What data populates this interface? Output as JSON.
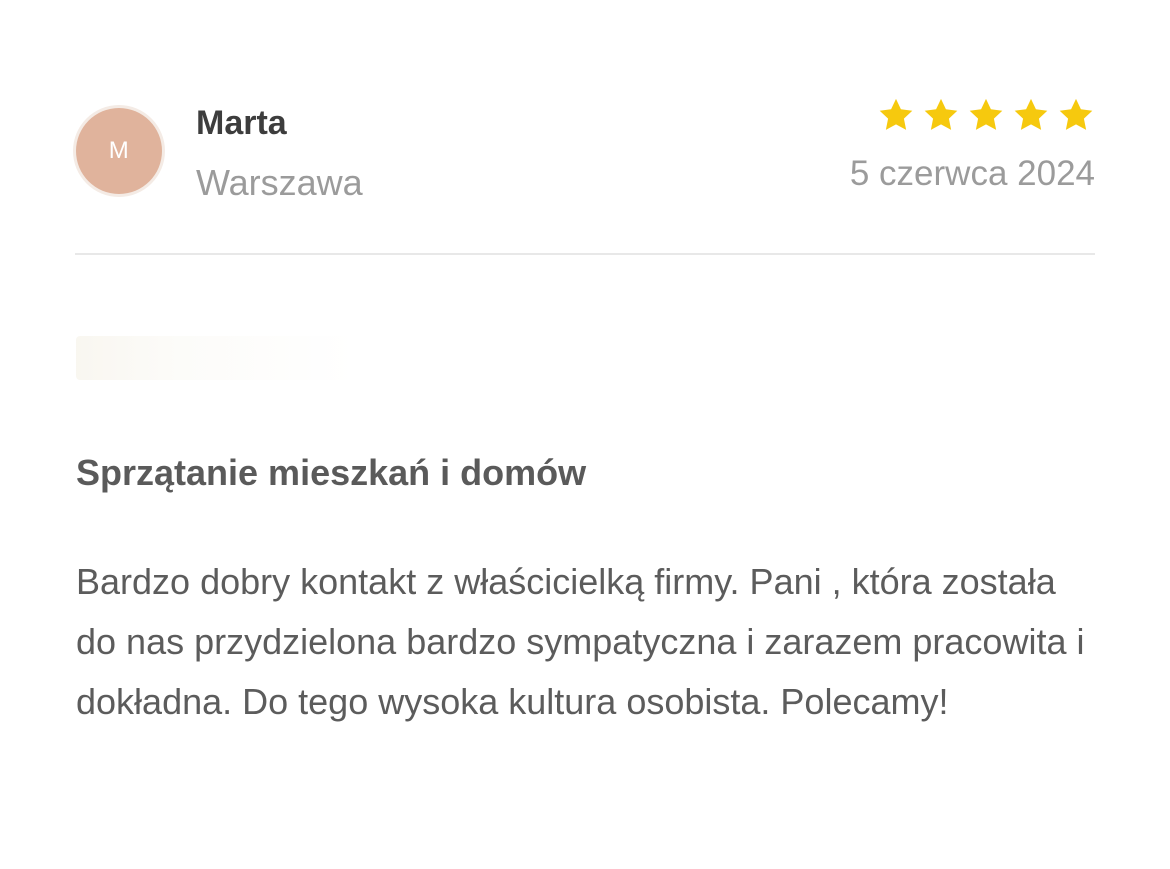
{
  "review": {
    "avatar_letter": "M",
    "name": "Marta",
    "city": "Warszawa",
    "rating": 5,
    "rating_max": 5,
    "date": "5 czerwca 2024",
    "service": "Sprzątanie mieszkań i domów",
    "text": "Bardzo dobry kontakt z właścicielką firmy. Pani , która została do nas przydzielona bardzo sympatyczna i zarazem pracowita i dokładna. Do tego wysoka kultura osobista. Polecamy!"
  },
  "colors": {
    "star": "#f6c90e",
    "avatar": "#e0b39c"
  },
  "icons": {
    "star": "star-icon"
  }
}
